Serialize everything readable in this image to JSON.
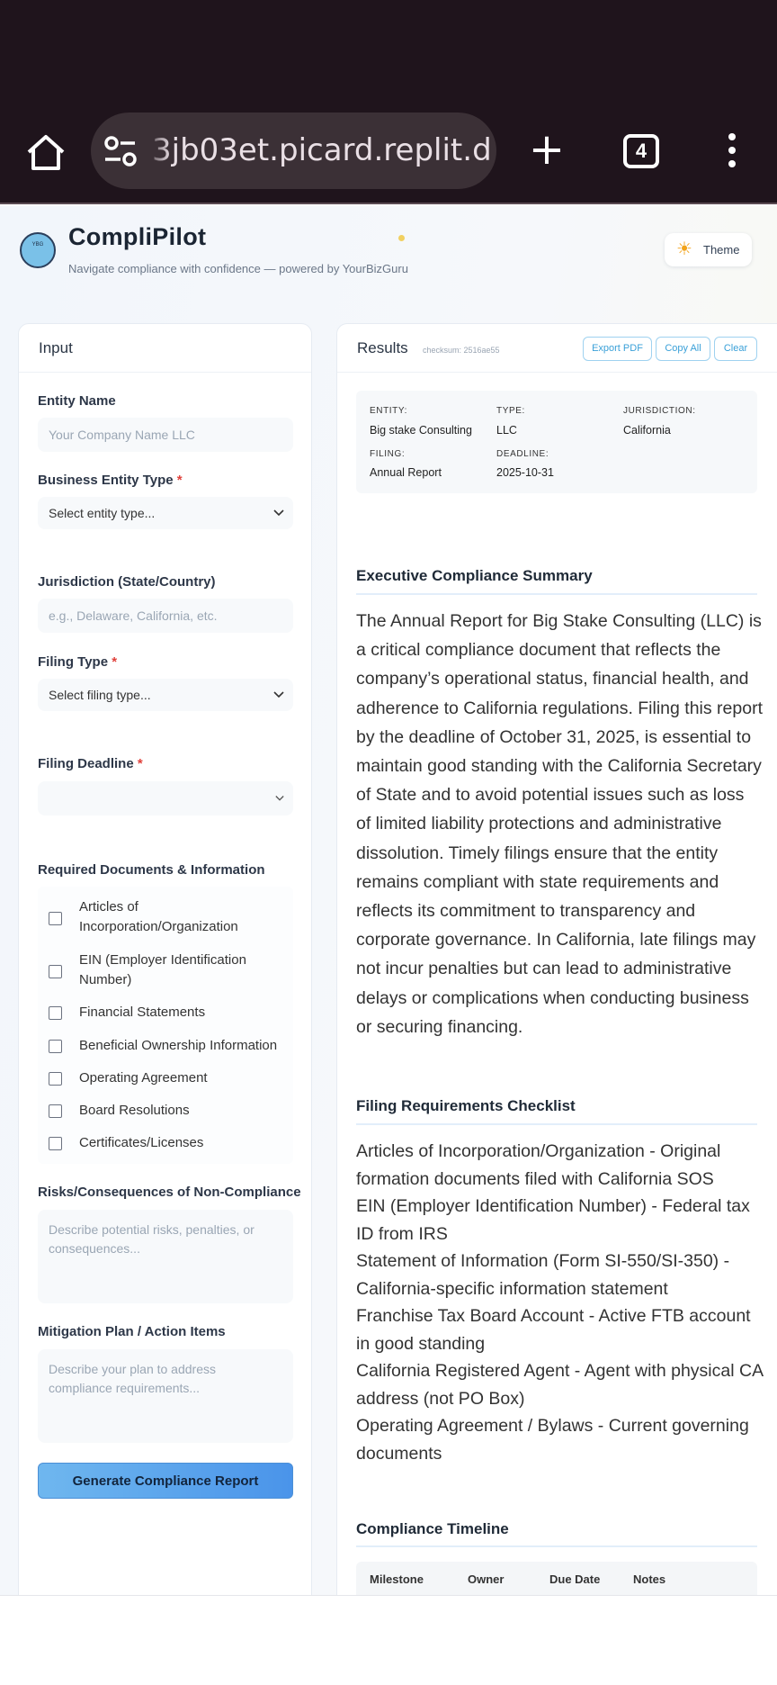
{
  "browser": {
    "url": "3jb03et.picard.replit.dev",
    "tab_count": "4"
  },
  "header": {
    "logo_text": "YBG",
    "title": "CompliPilot",
    "tagline": "Navigate compliance with confidence — powered by YourBizGuru",
    "theme_label": "Theme"
  },
  "input": {
    "title": "Input",
    "entity_name_label": "Entity Name",
    "entity_name_placeholder": "Your Company Name LLC",
    "entity_type_label": "Business Entity Type",
    "entity_type_value": "Select entity type...",
    "jurisdiction_label": "Jurisdiction (State/Country)",
    "jurisdiction_placeholder": "e.g., Delaware, California, etc.",
    "filing_type_label": "Filing Type",
    "filing_type_value": "Select filing type...",
    "deadline_label": "Filing Deadline",
    "required_star": "*",
    "docs_label": "Required Documents & Information",
    "docs": [
      "Articles of Incorporation/Organization",
      "EIN (Employer Identification Number)",
      "Financial Statements",
      "Beneficial Ownership Information",
      "Operating Agreement",
      "Board Resolutions",
      "Certificates/Licenses"
    ],
    "risks_label": "Risks/Consequences of Non-Compliance",
    "risks_placeholder": "Describe potential risks, penalties, or consequences...",
    "mitigation_label": "Mitigation Plan / Action Items",
    "mitigation_placeholder": "Describe your plan to address compliance requirements...",
    "generate_label": "Generate Compliance Report"
  },
  "results": {
    "title": "Results",
    "checksum": "checksum: 2516ae55",
    "export_label": "Export PDF",
    "copy_label": "Copy All",
    "clear_label": "Clear",
    "meta": {
      "entity_key": "ENTITY:",
      "entity_val": "Big stake Consulting",
      "type_key": "TYPE:",
      "type_val": "LLC",
      "jurisdiction_key": "JURISDICTION:",
      "jurisdiction_val": "California",
      "filing_key": "FILING:",
      "filing_val": "Annual Report",
      "deadline_key": "DEADLINE:",
      "deadline_val": "2025-10-31"
    },
    "summary_title": "Executive Compliance Summary",
    "summary_text": "The Annual Report for Big Stake Consulting (LLC) is a critical compliance document that reflects the company’s operational status, financial health, and adherence to California regulations. Filing this report by the deadline of October 31, 2025, is essential to maintain good standing with the California Secretary of State and to avoid potential issues such as loss of limited liability protections and administrative dissolution. Timely filings ensure that the entity remains compliant with state requirements and reflects its commitment to transparency and corporate governance. In California, late filings may not incur penalties but can lead to administrative delays or complications when conducting business or securing financing.",
    "checklist_title": "Filing Requirements Checklist",
    "checklist": [
      "Articles of Incorporation/Organization - Original formation documents filed with California SOS",
      "EIN (Employer Identification Number) - Federal tax ID from IRS",
      "Statement of Information (Form SI-550/SI-350) - California-specific information statement",
      "Franchise Tax Board Account - Active FTB account in good standing",
      "California Registered Agent - Agent with physical CA address (not PO Box)",
      "Operating Agreement / Bylaws - Current governing documents"
    ],
    "timeline_title": "Compliance Timeline",
    "timeline_columns": [
      "Milestone",
      "Owner",
      "Due Date",
      "Notes"
    ]
  }
}
